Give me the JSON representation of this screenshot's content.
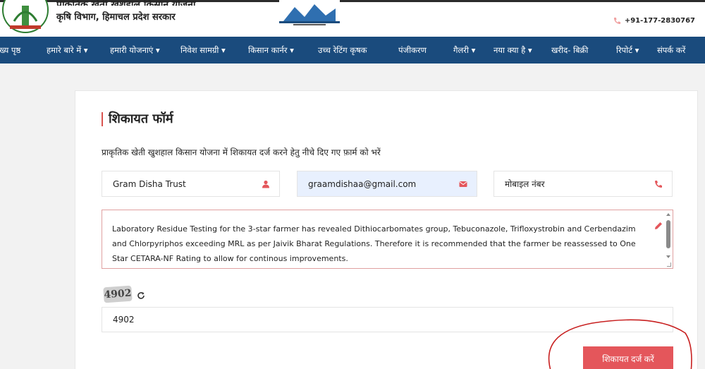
{
  "header": {
    "title": "प्राकृतिक खेती खुशहाल किसान योजना",
    "subtitle": "कृषि विभाग, हिमाचल प्रदेश सरकार",
    "phone": "+91-177-2830767"
  },
  "nav": {
    "items": [
      {
        "label": "मुख्य पृष्ठ"
      },
      {
        "label": "हमारे बारे में ▾"
      },
      {
        "label": "हमारी योजनाएं ▾"
      },
      {
        "label": "निवेश सामग्री ▾"
      },
      {
        "label": "किसान कार्नर ▾"
      },
      {
        "label": "उच्च रेटिंग कृषक"
      },
      {
        "label": "पंजीकरण"
      },
      {
        "label": "गैलरी ▾"
      },
      {
        "label": "नया क्या है ▾"
      },
      {
        "label": "खरीद- बिक्री"
      },
      {
        "label": "रिपोर्ट ▾"
      },
      {
        "label": "संपर्क करें"
      }
    ]
  },
  "form": {
    "title": "शिकायत फॉर्म",
    "description": "प्राकृतिक खेती खुशहाल किसान योजना में शिकायत दर्ज करने हेतु नीचे दिए गए फ़ार्म को भरें",
    "name_value": "Gram Disha Trust",
    "email_value": "graamdishaa@gmail.com",
    "mobile_placeholder": "मोबाइल नंबर",
    "complaint_text": "Laboratory Residue Testing for the 3-star farmer has revealed  Dithiocarbomates group, Tebuconazole, Trifloxystrobin and Cerbendazim and Chlorpyriphos exceeding MRL as per Jaivik Bharat Regulations. Therefore it is recommended that the farmer be reassessed to One Star CETARA-NF Rating to allow for continous improvements.",
    "captcha_image_text": "4902",
    "captcha_value": "4902",
    "submit_label": "शिकायत दर्ज करें"
  },
  "colors": {
    "navbar": "#1a4b7d",
    "submit": "#e4565b",
    "accent": "#d9534f",
    "email_bg": "#e8f0fe"
  },
  "icons": {
    "name": "user-icon",
    "email": "envelope-icon",
    "mobile": "phone-icon",
    "complaint": "pencil-icon",
    "captcha": "refresh-icon"
  }
}
